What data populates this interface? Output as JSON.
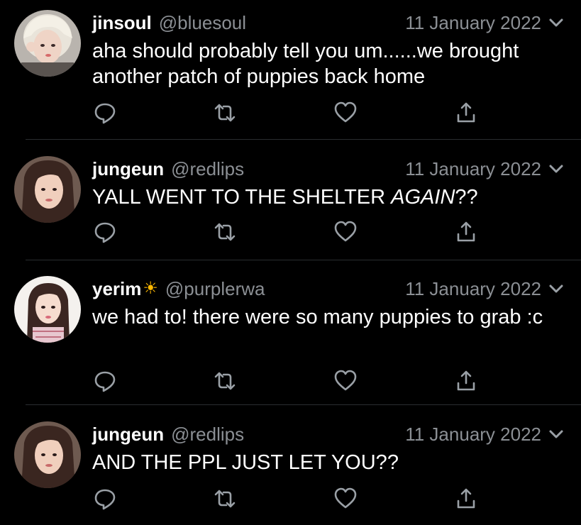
{
  "tweets": [
    {
      "name": "jinsoul",
      "emoji": "",
      "handle": "@bluesoul",
      "date": "11 January 2022",
      "text_parts": [
        "aha should probably tell you um......we brought another patch of puppies back home",
        "",
        ""
      ],
      "avatar": "jinsoul-avatar"
    },
    {
      "name": "jungeun",
      "emoji": "",
      "handle": "@redlips",
      "date": "11 January 2022",
      "text_parts": [
        "YALL WENT TO THE SHELTER ",
        "AGAIN",
        "??"
      ],
      "avatar": "jungeun-avatar"
    },
    {
      "name": "yerim",
      "emoji": "☀",
      "handle": "@purplerwa",
      "date": "11 January 2022",
      "text_parts": [
        "we had to! there were so many puppies to grab :c",
        "",
        ""
      ],
      "avatar": "yerim-avatar"
    },
    {
      "name": "jungeun",
      "emoji": "",
      "handle": "@redlips",
      "date": "11 January 2022",
      "text_parts": [
        "AND THE PPL JUST LET YOU??",
        "",
        ""
      ],
      "avatar": "jungeun-avatar"
    }
  ],
  "icons": {
    "reply": "reply-icon",
    "retweet": "retweet-icon",
    "like": "heart-icon",
    "share": "share-icon",
    "more": "chevron-down-icon"
  },
  "colors": {
    "background": "#000000",
    "text": "#ffffff",
    "muted": "#8b8f94",
    "separator": "#2a2d30"
  }
}
